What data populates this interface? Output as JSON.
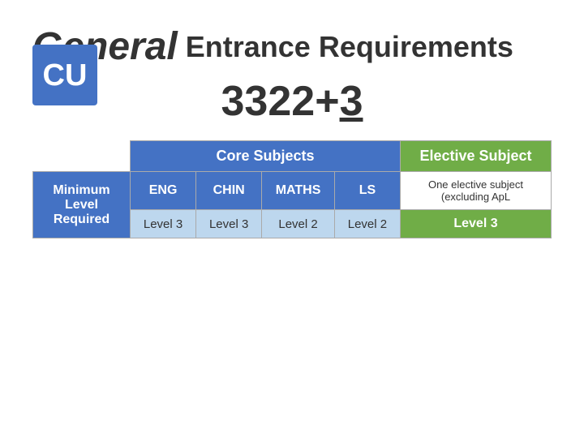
{
  "title": {
    "general": "General",
    "subtitle": "Entrance Requirements"
  },
  "score": {
    "display": "3322+3",
    "underline_char": "3"
  },
  "table": {
    "row_label": "Minimum\nLevel\nRequired",
    "core_header": "Core Subjects",
    "elective_header": "Elective Subject",
    "subjects": [
      "ENG",
      "CHIN",
      "MATHS",
      "LS"
    ],
    "levels": [
      "Level 3",
      "Level 3",
      "Level 2",
      "Level 2"
    ],
    "elective_subject_text": "One elective subject (excluding ApL",
    "elective_level": "Level 3"
  },
  "colors": {
    "blue": "#4472c4",
    "green": "#70ad47",
    "light_blue": "#bdd7ee",
    "white": "#ffffff",
    "dark": "#333333"
  }
}
